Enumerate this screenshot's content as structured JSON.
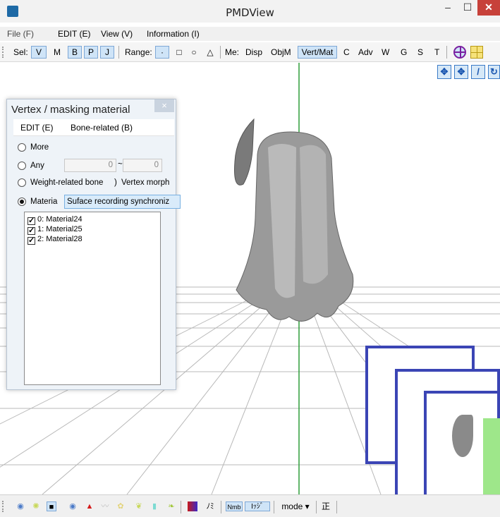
{
  "window": {
    "title": "PMDView"
  },
  "menubar": {
    "file": "File (F)",
    "edit": "EDIT (E)",
    "view": "View (V)",
    "info": "Information (I)"
  },
  "toolbar": {
    "sel_label": "Sel:",
    "v": "V",
    "m": "M",
    "b": "B",
    "p": "P",
    "j": "J",
    "range_label": "Range:",
    "range_dot": "·",
    "range_rect": "□",
    "range_circle": "○",
    "range_tri": "△",
    "me_label": "Me:",
    "disp": "Disp",
    "objm": "ObjM",
    "vertmat": "Vert/Mat",
    "c": "C",
    "adv": "Adv",
    "w": "W",
    "g": "G",
    "s": "S",
    "t": "T"
  },
  "panel": {
    "title": "Vertex / masking material",
    "close": "×",
    "menu_edit": "EDIT (E)",
    "menu_bone": "Bone-related (B)",
    "opt_more": "More",
    "opt_any": "Any",
    "any_from": "0",
    "any_tilde": "~",
    "any_to": "0",
    "opt_weight": "Weight-related bone",
    "opt_paren": ")",
    "opt_vertex_morph": "Vertex morph",
    "opt_material": "Materia",
    "combo_value": "Suface recording synchroniz",
    "materials": [
      {
        "label": "0: Material24",
        "checked": true
      },
      {
        "label": "1: Material25",
        "checked": true
      },
      {
        "label": "2: Material28",
        "checked": true
      }
    ]
  },
  "bottombar": {
    "nomi": "ﾉﾐ",
    "nmb": "Nmb",
    "ejji": "Iｯｼﾞ",
    "mode": "mode ▾",
    "sei": "正"
  },
  "colors": {
    "selected_button": "#cfe4f7",
    "overlay_border": "#3b45b5",
    "axis_green": "#2e9e3a",
    "close_red": "#c7413a"
  },
  "icons": [
    "app-icon",
    "minimize-icon",
    "maximize-icon",
    "close-icon",
    "move-icon",
    "rotate-icon"
  ]
}
